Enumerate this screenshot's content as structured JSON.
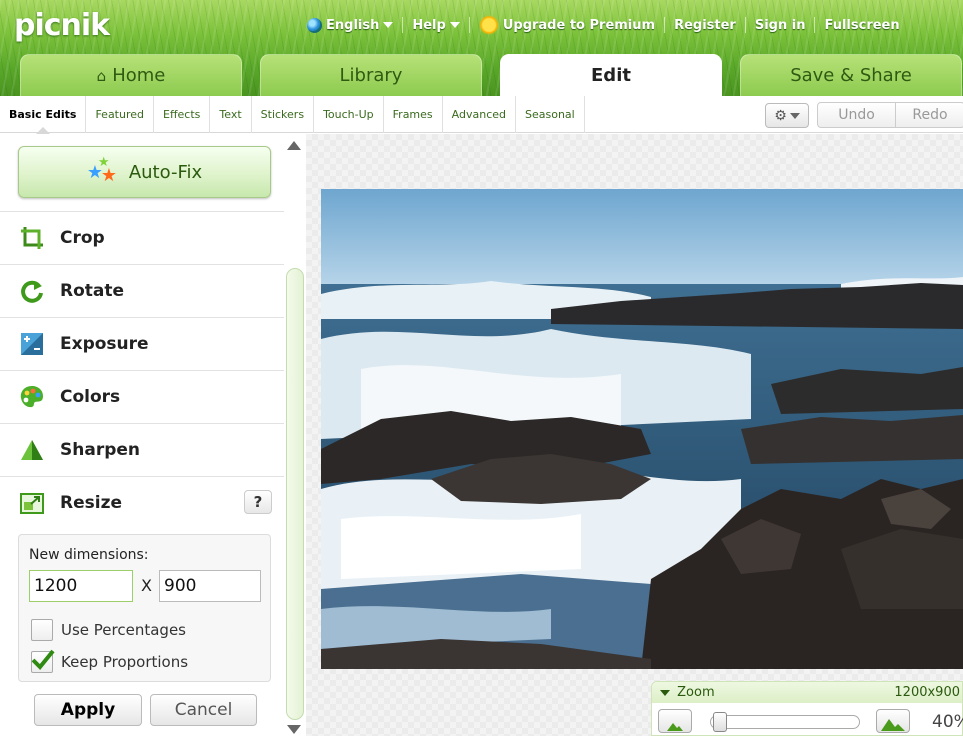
{
  "app": {
    "logo": "picnik"
  },
  "topbar": {
    "language": "English",
    "help": "Help",
    "upgrade": "Upgrade to Premium",
    "register": "Register",
    "signin": "Sign in",
    "fullscreen": "Fullscreen"
  },
  "main_tabs": [
    {
      "label": "Home"
    },
    {
      "label": "Library"
    },
    {
      "label": "Edit"
    },
    {
      "label": "Save & Share"
    }
  ],
  "sub_tabs": [
    {
      "label": "Basic Edits"
    },
    {
      "label": "Featured"
    },
    {
      "label": "Effects"
    },
    {
      "label": "Text"
    },
    {
      "label": "Stickers"
    },
    {
      "label": "Touch-Up"
    },
    {
      "label": "Frames"
    },
    {
      "label": "Advanced"
    },
    {
      "label": "Seasonal"
    }
  ],
  "toolbar": {
    "undo": "Undo",
    "redo": "Redo"
  },
  "panel": {
    "autofix": "Auto-Fix",
    "tools": [
      {
        "label": "Crop",
        "icon": "crop-icon"
      },
      {
        "label": "Rotate",
        "icon": "rotate-icon"
      },
      {
        "label": "Exposure",
        "icon": "exposure-icon"
      },
      {
        "label": "Colors",
        "icon": "palette-icon"
      },
      {
        "label": "Sharpen",
        "icon": "sharpen-icon"
      },
      {
        "label": "Resize",
        "icon": "resize-icon"
      }
    ],
    "help": "?",
    "resize": {
      "label": "New dimensions:",
      "width": "1200",
      "x": "X",
      "height": "900",
      "use_percentages": "Use Percentages",
      "use_percentages_checked": false,
      "keep_proportions": "Keep Proportions",
      "keep_proportions_checked": true,
      "apply": "Apply",
      "cancel": "Cancel"
    }
  },
  "zoom": {
    "title": "Zoom",
    "size": "1200x900",
    "percent": "40%",
    "level": 0.0
  },
  "colors": {
    "accent": "#7cc23a",
    "tab_inactive": "#8ccb4f",
    "link": "#3a6a1e"
  }
}
